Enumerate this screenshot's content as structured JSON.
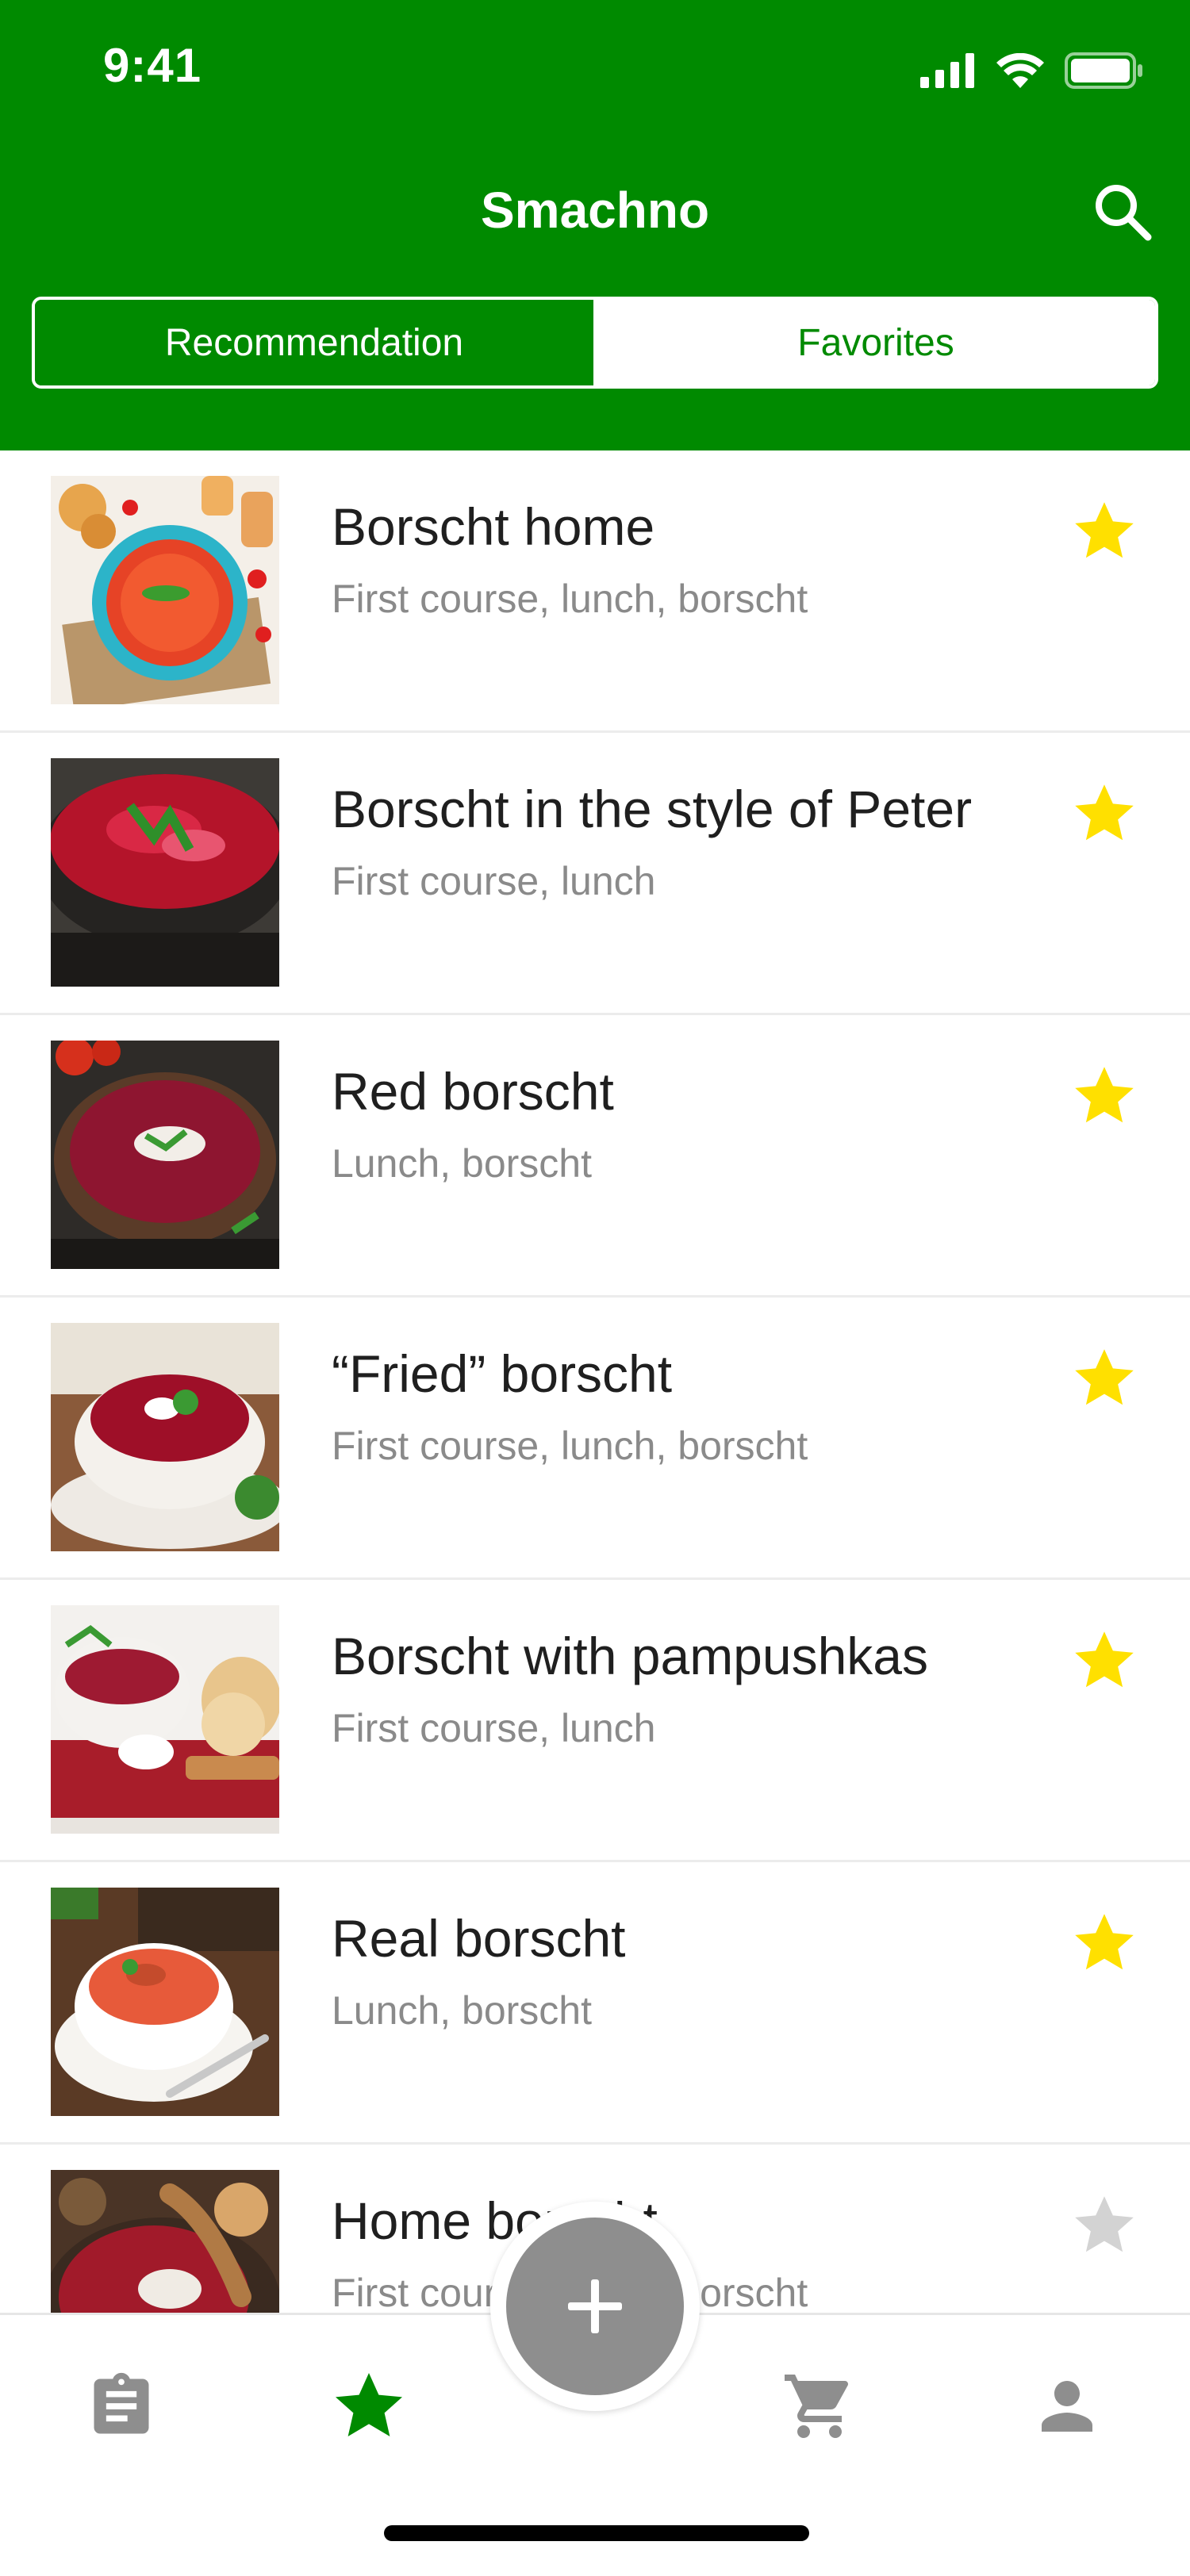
{
  "status": {
    "time": "9:41"
  },
  "header": {
    "title": "Smachno",
    "tabs": [
      {
        "label": "Recommendation",
        "active": true
      },
      {
        "label": "Favorites",
        "active": false
      }
    ]
  },
  "colors": {
    "brand_green": "#008a00",
    "star_active": "#ffe000",
    "star_inactive": "#d3d3d3",
    "icon_gray": "#8e8e8e"
  },
  "recipes": [
    {
      "title": "Borscht home",
      "subtitle": "First course, lunch, borscht",
      "favorite": true
    },
    {
      "title": "Borscht in the style of Peter",
      "subtitle": "First course, lunch",
      "favorite": true
    },
    {
      "title": "Red borscht",
      "subtitle": "Lunch, borscht",
      "favorite": true
    },
    {
      "title": "“Fried” borscht",
      "subtitle": "First course, lunch, borscht",
      "favorite": true
    },
    {
      "title": "Borscht with pampushkas",
      "subtitle": "First course, lunch",
      "favorite": true
    },
    {
      "title": "Real borscht",
      "subtitle": "Lunch, borscht",
      "favorite": true
    },
    {
      "title": "Home borscht",
      "subtitle": "First course, lunch, borscht",
      "favorite": false
    }
  ],
  "tabbar": {
    "icons": [
      "clipboard-icon",
      "star-icon",
      "add-icon",
      "cart-icon",
      "profile-icon"
    ],
    "active": "star-icon"
  }
}
